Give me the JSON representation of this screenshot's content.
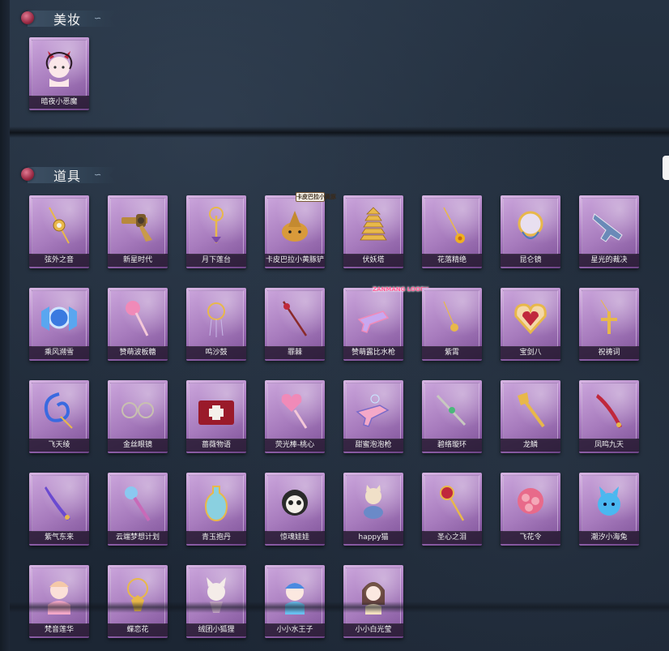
{
  "sections": {
    "makeup": {
      "title": "美妆"
    },
    "props": {
      "title": "道具"
    }
  },
  "makeup_items": [
    {
      "label": "暗夜小恶魔",
      "icon": "devil-girl-icon"
    }
  ],
  "prop_items": [
    {
      "label": "弦外之音",
      "icon": "pendant-staff-icon"
    },
    {
      "label": "新星时代",
      "icon": "revolver-icon"
    },
    {
      "label": "月下莲台",
      "icon": "lotus-scepter-icon"
    },
    {
      "label": "卡皮巴拉小黄豚铲",
      "icon": "capybara-icon",
      "badge": "卡皮巴拉小黄豚"
    },
    {
      "label": "伏妖塔",
      "icon": "pagoda-icon"
    },
    {
      "label": "花落精绝",
      "icon": "flower-pendulum-icon"
    },
    {
      "label": "昆仑镜",
      "icon": "mirror-icon"
    },
    {
      "label": "星光的裁决",
      "icon": "star-gun-icon"
    },
    {
      "label": "乘风溯雪",
      "icon": "blue-crystal-icon"
    },
    {
      "label": "赞萌波板糖",
      "icon": "lollipop-icon"
    },
    {
      "label": "鸣沙鼓",
      "icon": "dreamcatcher-icon"
    },
    {
      "label": "罪棘",
      "icon": "thorn-staff-icon"
    },
    {
      "label": "赞萌露比水枪",
      "icon": "water-gun-icon",
      "badge": "ZANMANG LOOPY"
    },
    {
      "label": "紫霄",
      "icon": "pendant-icon"
    },
    {
      "label": "宝剑八",
      "icon": "heart-locket-icon"
    },
    {
      "label": "祝祷词",
      "icon": "cross-icon"
    },
    {
      "label": "飞天绫",
      "icon": "ribbon-icon"
    },
    {
      "label": "金丝眼镜",
      "icon": "glasses-icon"
    },
    {
      "label": "蔷薇物语",
      "icon": "medkit-icon"
    },
    {
      "label": "荧光棒-桃心",
      "icon": "heart-wand-icon"
    },
    {
      "label": "甜蜜泡泡枪",
      "icon": "bubble-gun-icon"
    },
    {
      "label": "碧络璇环",
      "icon": "jade-sword-icon"
    },
    {
      "label": "龙鳞",
      "icon": "golden-shovel-icon"
    },
    {
      "label": "凤鸣九天",
      "icon": "phoenix-blade-icon"
    },
    {
      "label": "紫气东来",
      "icon": "purple-sabre-icon"
    },
    {
      "label": "云端梦想计划",
      "icon": "rocket-wand-icon"
    },
    {
      "label": "青玉抱丹",
      "icon": "jade-vase-icon"
    },
    {
      "label": "惊魂娃娃",
      "icon": "skull-doll-icon"
    },
    {
      "label": "happy猫",
      "icon": "happy-cat-icon"
    },
    {
      "label": "圣心之泪",
      "icon": "ruby-scepter-icon"
    },
    {
      "label": "飞花令",
      "icon": "flower-lantern-icon"
    },
    {
      "label": "潮汐小海兔",
      "icon": "sea-bunny-icon"
    },
    {
      "label": "梵音莲华",
      "icon": "lotus-girl-icon"
    },
    {
      "label": "蝶恋花",
      "icon": "butterfly-bell-icon"
    },
    {
      "label": "绒团小狐狸",
      "icon": "fox-icon"
    },
    {
      "label": "小小水王子",
      "icon": "water-prince-icon"
    },
    {
      "label": "小小白光莹",
      "icon": "white-light-girl-icon"
    }
  ],
  "colors": {
    "background": "#1d2836",
    "card_purple": "#b487c9",
    "label_bg": "#261a30"
  }
}
